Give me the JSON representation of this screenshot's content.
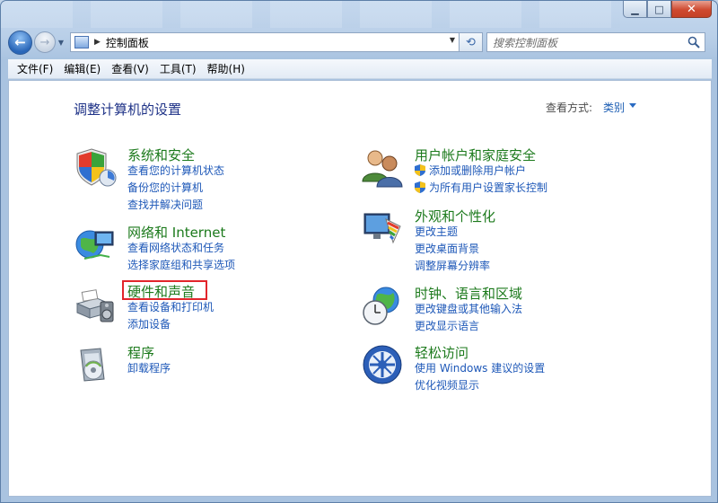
{
  "window": {
    "minimize_icon": "minimize-icon",
    "maximize_icon": "maximize-icon",
    "close_icon": "close-icon"
  },
  "navigation": {
    "address_path": "控制面板",
    "search_placeholder": "搜索控制面板"
  },
  "menu": {
    "items": [
      "文件(F)",
      "编辑(E)",
      "查看(V)",
      "工具(T)",
      "帮助(H)"
    ]
  },
  "content": {
    "title": "调整计算机的设置",
    "view_by_label": "查看方式:",
    "view_by_value": "类别"
  },
  "categories": [
    {
      "title": "系统和安全",
      "icon": "system-security-icon",
      "links": [
        "查看您的计算机状态",
        "备份您的计算机",
        "查找并解决问题"
      ]
    },
    {
      "title": "网络和 Internet",
      "icon": "network-internet-icon",
      "links": [
        "查看网络状态和任务",
        "选择家庭组和共享选项"
      ]
    },
    {
      "title": "硬件和声音",
      "icon": "hardware-sound-icon",
      "links": [
        "查看设备和打印机",
        "添加设备"
      ]
    },
    {
      "title": "程序",
      "icon": "programs-icon",
      "links": [
        "卸载程序"
      ]
    },
    {
      "title": "用户帐户和家庭安全",
      "icon": "user-accounts-icon",
      "links": [
        "添加或删除用户帐户",
        "为所有用户设置家长控制"
      ]
    },
    {
      "title": "外观和个性化",
      "icon": "appearance-icon",
      "links": [
        "更改主题",
        "更改桌面背景",
        "调整屏幕分辨率"
      ]
    },
    {
      "title": "时钟、语言和区域",
      "icon": "clock-language-icon",
      "links": [
        "更改键盘或其他输入法",
        "更改显示语言"
      ]
    },
    {
      "title": "轻松访问",
      "icon": "ease-of-access-icon",
      "links": [
        "使用 Windows 建议的设置",
        "优化视频显示"
      ]
    }
  ],
  "colors": {
    "category_title": "#1c7a1c",
    "link": "#1e58b8",
    "page_title": "#1e3287",
    "highlight_box": "#e2252b"
  }
}
